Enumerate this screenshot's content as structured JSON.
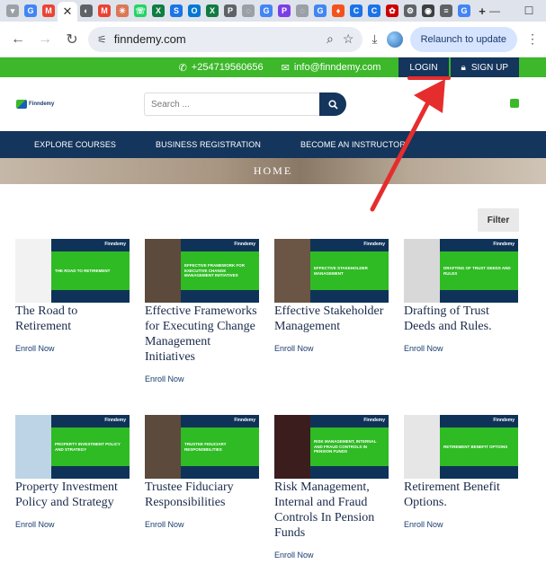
{
  "browser": {
    "tab_active_close": "✕",
    "new_tab": "+",
    "url": "finndemy.com",
    "relaunch_label": "Relaunch to update"
  },
  "site": {
    "phone": "+254719560656",
    "email": "info@finndemy.com",
    "login_label": "LOGIN",
    "signup_label": "SIGN UP",
    "logo_text": "Finndemy",
    "search_placeholder": "Search ...",
    "nav": [
      "EXPLORE COURSES",
      "BUSINESS REGISTRATION",
      "BECOME AN INSTRUCTOR"
    ],
    "hero_title": "HOME",
    "filter_label": "Filter",
    "brand_colors": {
      "green": "#3cb82a",
      "navy": "#14355c"
    }
  },
  "courses": [
    {
      "title": "The Road to Retirement",
      "banner": "THE ROAD TO RETIREMENT",
      "enroll": "Enroll Now",
      "brand": "Finndemy"
    },
    {
      "title": "Effective Frameworks for Executing Change Management Initiatives",
      "banner": "EFFECTIVE FRAMEWORK FOR EXECUTIVE CHANGE MANAGEMENT INITIATIVES",
      "enroll": "Enroll Now",
      "brand": "Finndemy"
    },
    {
      "title": "Effective Stakeholder Management",
      "banner": "EFFECTIVE STAKEHOLDER MANAGEMENT",
      "enroll": "Enroll Now",
      "brand": "Finndemy"
    },
    {
      "title": "Drafting of Trust Deeds and Rules.",
      "banner": "DRAFTING OF TRUST DEEDS AND RULES",
      "enroll": "Enroll Now",
      "brand": "Finndemy"
    },
    {
      "title": "Property Investment Policy and Strategy",
      "banner": "PROPERTY INVESTMENT POLICY AND STRATEGY",
      "enroll": "Enroll Now",
      "brand": "Finndemy"
    },
    {
      "title": "Trustee Fiduciary Responsibilities",
      "banner": "TRUSTEE FIDUCIARY RESPONSIBILITIES",
      "enroll": "Enroll Now",
      "brand": "Finndemy"
    },
    {
      "title": "Risk Management, Internal and Fraud Controls In Pension Funds",
      "banner": "RISK MANAGEMENT, INTERNAL AND FRAUD CONTROLS IN PENSION FUNDS",
      "enroll": "Enroll Now",
      "brand": "Finndemy"
    },
    {
      "title": "Retirement Benefit Options.",
      "banner": "RETIREMENT BENEFIT OPTIONS",
      "enroll": "Enroll Now",
      "brand": "Finndemy"
    }
  ]
}
